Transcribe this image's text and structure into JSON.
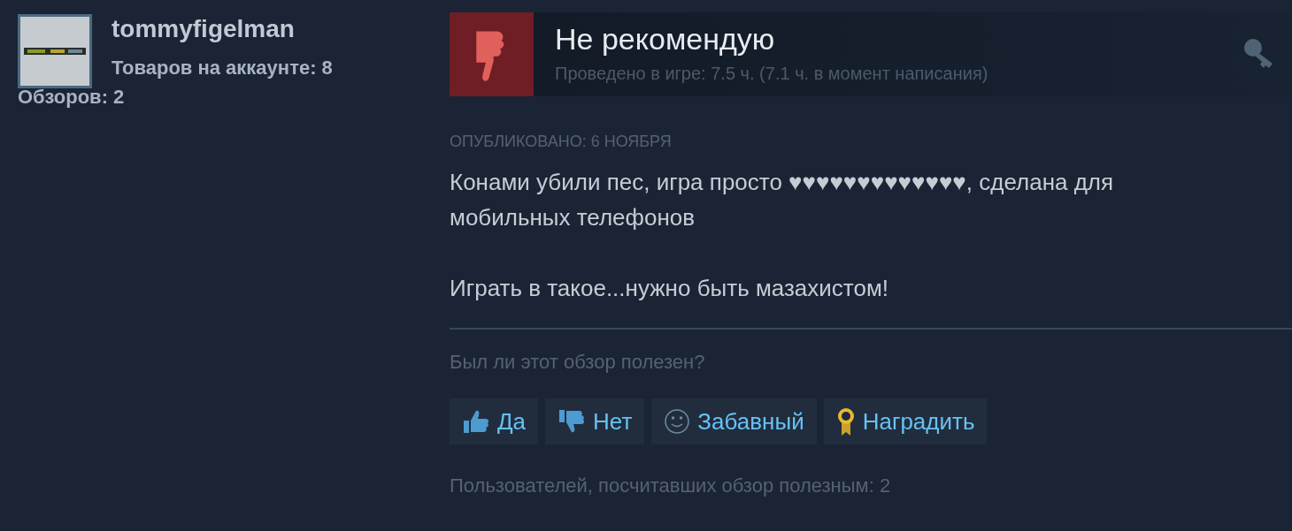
{
  "author": {
    "name": "tommyfigelman",
    "products": "Товаров на аккаунте: 8",
    "reviews": "Обзоров: 2"
  },
  "review": {
    "recommended": false,
    "title": "Не рекомендую",
    "playtime": "Проведено в игре: 7.5 ч. (7.1 ч. в момент написания)",
    "posted": "ОПУБЛИКОВАНО: 6 НОЯБРЯ",
    "paragraphs": [
      "Конами убили пес, игра просто ♥♥♥♥♥♥♥♥♥♥♥♥♥, сделана для мобильных телефонов",
      "Играть в такое...нужно быть мазахистом!"
    ]
  },
  "helpful_prompt": "Был ли этот обзор полезен?",
  "buttons": [
    {
      "kind": "yes",
      "label": "Да"
    },
    {
      "kind": "no",
      "label": "Нет"
    },
    {
      "kind": "funny",
      "label": "Забавный"
    },
    {
      "kind": "award",
      "label": "Наградить"
    }
  ],
  "helpful_count": "Пользователей, посчитавших обзор полезным: 2"
}
